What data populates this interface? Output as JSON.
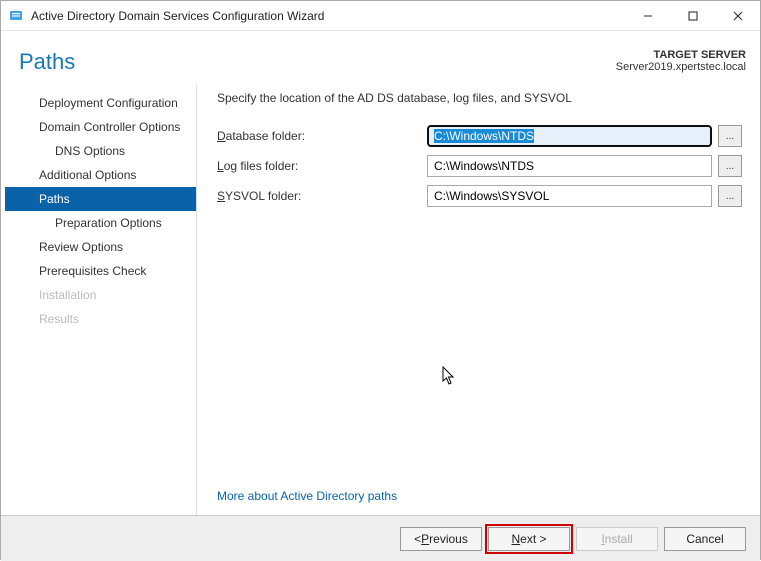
{
  "window": {
    "title": "Active Directory Domain Services Configuration Wizard"
  },
  "header": {
    "page_title": "Paths",
    "target_label": "TARGET SERVER",
    "target_name": "Server2019.xpertstec.local"
  },
  "sidebar": {
    "items": [
      {
        "label": "Deployment Configuration",
        "indent": false,
        "selected": false,
        "disabled": false
      },
      {
        "label": "Domain Controller Options",
        "indent": false,
        "selected": false,
        "disabled": false
      },
      {
        "label": "DNS Options",
        "indent": true,
        "selected": false,
        "disabled": false
      },
      {
        "label": "Additional Options",
        "indent": false,
        "selected": false,
        "disabled": false
      },
      {
        "label": "Paths",
        "indent": false,
        "selected": true,
        "disabled": false
      },
      {
        "label": "Preparation Options",
        "indent": true,
        "selected": false,
        "disabled": false
      },
      {
        "label": "Review Options",
        "indent": false,
        "selected": false,
        "disabled": false
      },
      {
        "label": "Prerequisites Check",
        "indent": false,
        "selected": false,
        "disabled": false
      },
      {
        "label": "Installation",
        "indent": false,
        "selected": false,
        "disabled": true
      },
      {
        "label": "Results",
        "indent": false,
        "selected": false,
        "disabled": true
      }
    ]
  },
  "form": {
    "instruction": "Specify the location of the AD DS database, log files, and SYSVOL",
    "rows": [
      {
        "underlined": "D",
        "rest": "atabase folder:",
        "value": "C:\\Windows\\NTDS",
        "focused": true
      },
      {
        "underlined": "L",
        "rest": "og files folder:",
        "value": "C:\\Windows\\NTDS",
        "focused": false
      },
      {
        "underlined": "S",
        "rest": "YSVOL folder:",
        "value": "C:\\Windows\\SYSVOL",
        "focused": false
      }
    ],
    "more_link": "More about Active Directory paths"
  },
  "footer": {
    "previous_u": "P",
    "previous_tail": "revious",
    "previous_head": "< ",
    "next_u": "N",
    "next_rest": "ext >",
    "install_u": "I",
    "install_rest": "nstall",
    "cancel": "Cancel"
  }
}
